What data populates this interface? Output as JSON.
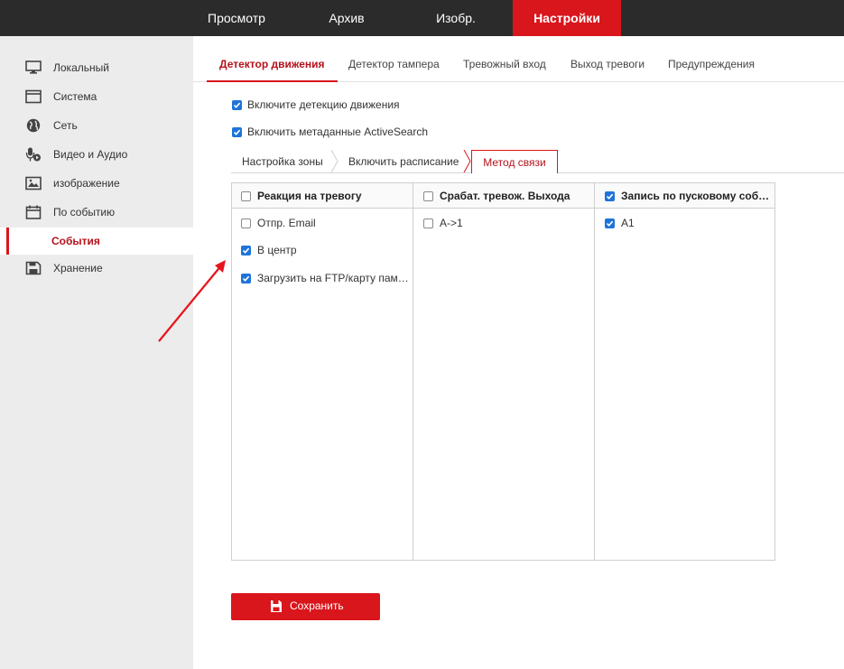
{
  "topnav": {
    "items": [
      {
        "label": "Просмотр"
      },
      {
        "label": "Архив"
      },
      {
        "label": "Изобр."
      },
      {
        "label": "Настройки"
      }
    ],
    "active_index": 3
  },
  "sidebar": {
    "items": [
      {
        "label": "Локальный",
        "icon": "monitor-icon"
      },
      {
        "label": "Система",
        "icon": "window-icon"
      },
      {
        "label": "Сеть",
        "icon": "globe-icon"
      },
      {
        "label": "Видео и Аудио",
        "icon": "microphone-icon"
      },
      {
        "label": "изображение",
        "icon": "image-icon"
      },
      {
        "label": "По событию",
        "icon": "calendar-icon"
      },
      {
        "label": "События",
        "icon": ""
      },
      {
        "label": "Хранение",
        "icon": "floppy-disk-icon"
      }
    ],
    "active_sub": "События"
  },
  "tabs": {
    "items": [
      {
        "label": "Детектор движения"
      },
      {
        "label": "Детектор тампера"
      },
      {
        "label": "Тревожный вход"
      },
      {
        "label": "Выход тревоги"
      },
      {
        "label": "Предупреждения"
      }
    ],
    "active_index": 0
  },
  "options": {
    "enable_motion": {
      "label": "Включите детекцию движения",
      "checked": true
    },
    "enable_metadata": {
      "label": "Включить метаданные ActiveSearch",
      "checked": true
    }
  },
  "subtabs": {
    "items": [
      {
        "label": "Настройка зоны"
      },
      {
        "label": "Включить расписание"
      },
      {
        "label": "Метод связи"
      }
    ],
    "active_index": 2
  },
  "linkage": {
    "columns": [
      {
        "header": "Реакция на тревогу",
        "header_checked": false,
        "rows": [
          {
            "label": "Отпр. Email",
            "checked": false
          },
          {
            "label": "В центр",
            "checked": true
          },
          {
            "label": "Загрузить на FTP/карту пам…",
            "checked": true
          }
        ]
      },
      {
        "header": "Срабат. тревож. Выхода",
        "header_checked": false,
        "rows": [
          {
            "label": "A->1",
            "checked": false
          }
        ]
      },
      {
        "header": "Запись по пусковому соб…",
        "header_checked": true,
        "rows": [
          {
            "label": "A1",
            "checked": true
          }
        ]
      }
    ]
  },
  "save": {
    "label": "Сохранить",
    "icon": "save-icon"
  },
  "colors": {
    "accent": "#d9161c",
    "topbar": "#2b2b2b",
    "checkbox": "#1e74d8",
    "sidebar": "#ececec"
  }
}
